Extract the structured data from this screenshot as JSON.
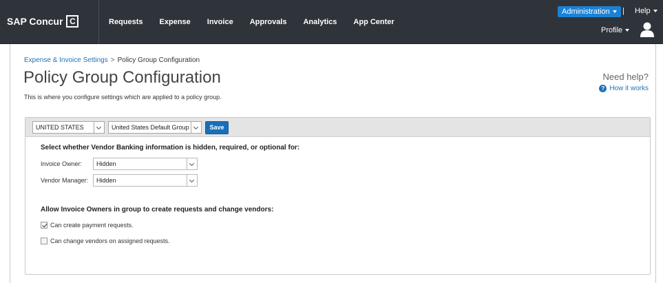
{
  "header": {
    "logo_text": "SAP Concur",
    "logo_mark": "C",
    "nav": [
      {
        "label": "Requests"
      },
      {
        "label": "Expense"
      },
      {
        "label": "Invoice"
      },
      {
        "label": "Approvals"
      },
      {
        "label": "Analytics"
      },
      {
        "label": "App Center"
      }
    ],
    "admin_label": "Administration",
    "separator": "|",
    "help_label": "Help",
    "profile_label": "Profile",
    "accent_color": "#1a82d6",
    "bar_color": "#2f343b"
  },
  "breadcrumb": {
    "parent": "Expense & Invoice Settings",
    "separator": ">",
    "current": "Policy Group Configuration"
  },
  "page": {
    "title": "Policy Group Configuration",
    "description": "This is where you configure settings which are applied to a policy group.",
    "need_help": "Need help?",
    "how_it_works": "How it works"
  },
  "toolbar": {
    "country": "UNITED STATES",
    "group": "United States Default Group",
    "save_label": "Save"
  },
  "banking": {
    "heading": "Select whether Vendor Banking information is hidden, required, or optional for:",
    "invoice_owner_label": "Invoice Owner:",
    "invoice_owner_value": "Hidden",
    "vendor_manager_label": "Vendor Manager:",
    "vendor_manager_value": "Hidden"
  },
  "permissions": {
    "heading": "Allow Invoice Owners in group to create requests and change vendors:",
    "options": [
      {
        "label": "Can create payment requests.",
        "checked": true
      },
      {
        "label": "Can change vendors on assigned requests.",
        "checked": false
      }
    ]
  }
}
